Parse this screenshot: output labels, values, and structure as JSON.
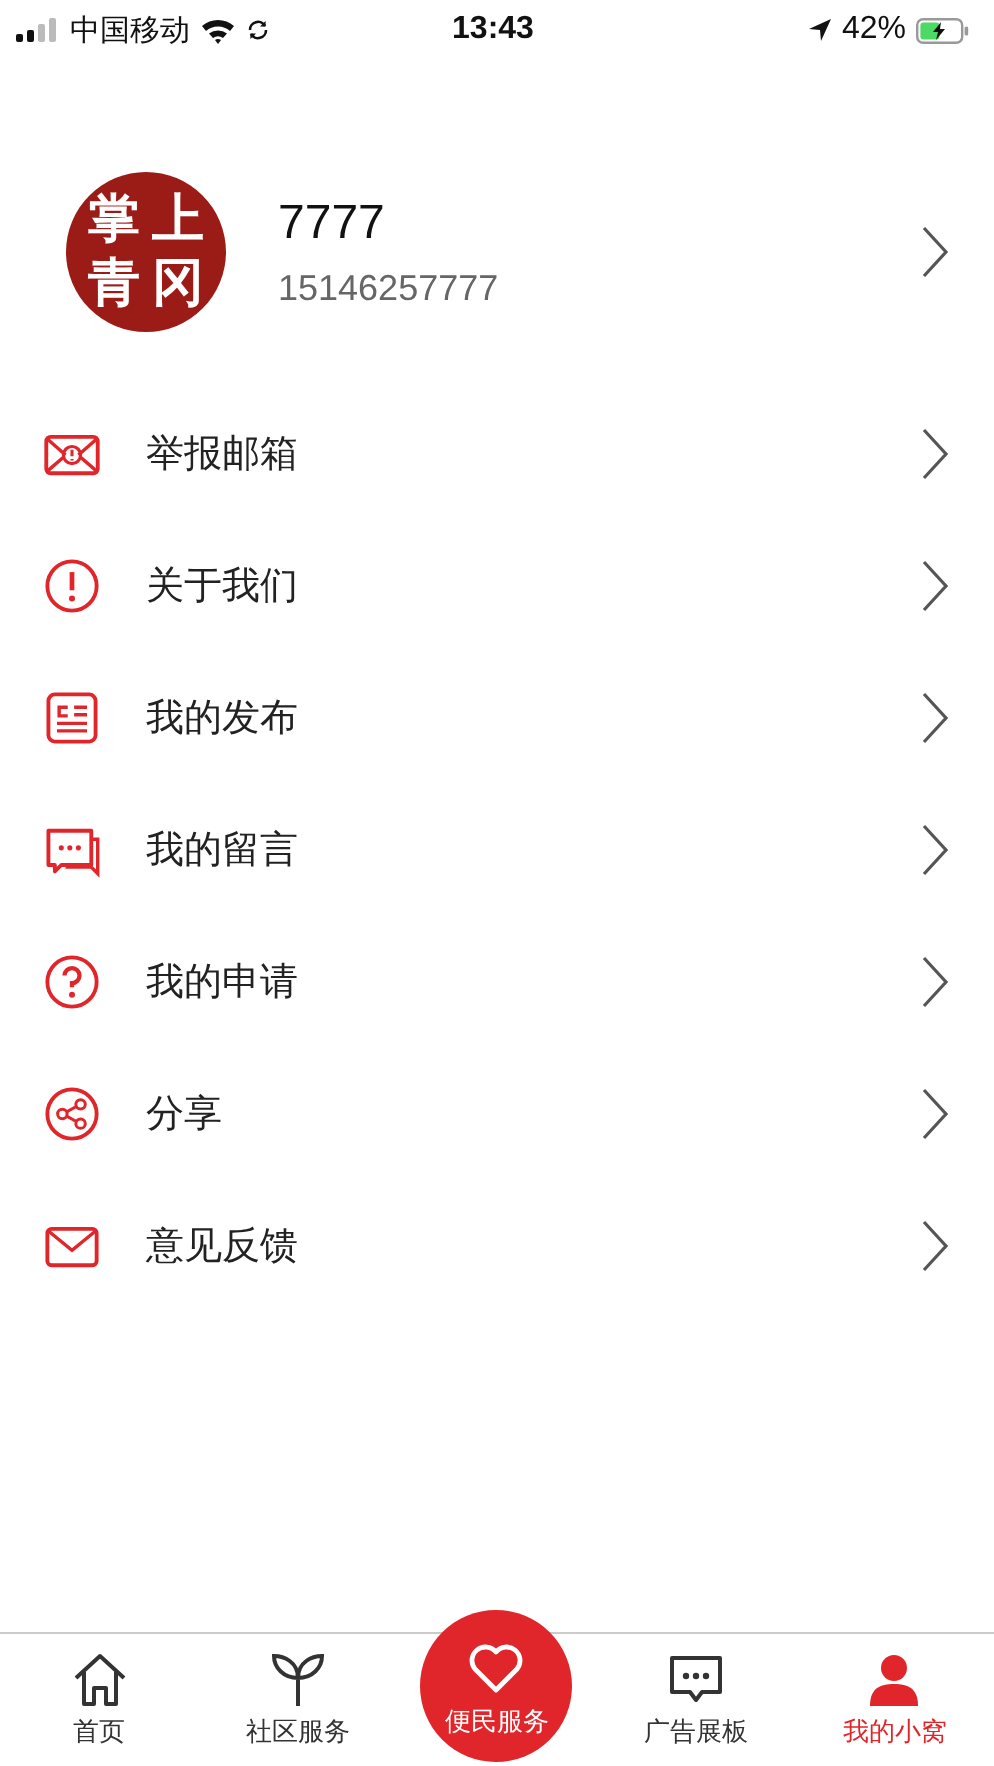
{
  "status_bar": {
    "carrier": "中国移动",
    "time": "13:43",
    "battery": "42%"
  },
  "profile": {
    "avatar_chars": [
      "掌",
      "上",
      "青",
      "冈"
    ],
    "name": "7777",
    "phone": "15146257777"
  },
  "menu": [
    {
      "kind": "report-mail",
      "label": "举报邮箱"
    },
    {
      "kind": "about",
      "label": "关于我们"
    },
    {
      "kind": "posts",
      "label": "我的发布"
    },
    {
      "kind": "messages",
      "label": "我的留言"
    },
    {
      "kind": "help",
      "label": "我的申请"
    },
    {
      "kind": "share",
      "label": "分享"
    },
    {
      "kind": "mail",
      "label": "意见反馈"
    }
  ],
  "tab_bar": [
    {
      "kind": "home",
      "label": "首页",
      "selected": false
    },
    {
      "kind": "sprout",
      "label": "社区服务",
      "selected": false
    },
    {
      "kind": "heart",
      "label": "便民服务",
      "selected": false
    },
    {
      "kind": "chat",
      "label": "广告展板",
      "selected": false
    },
    {
      "kind": "person",
      "label": "我的小窝",
      "selected": true
    }
  ]
}
